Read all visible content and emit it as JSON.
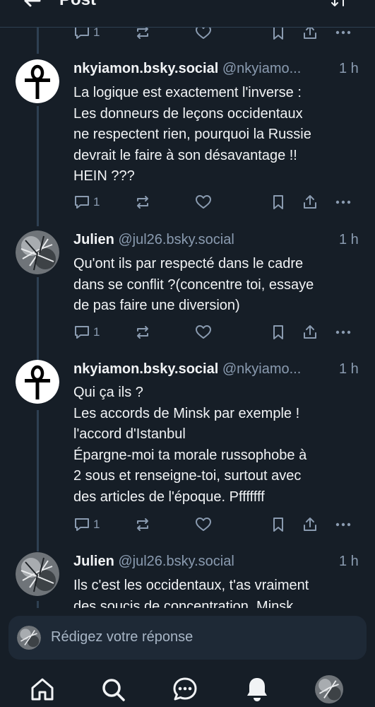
{
  "header": {
    "title": "Post"
  },
  "top_actions": {
    "reply_count": "1"
  },
  "posts": [
    {
      "display_name": "nkyiamon.bsky.social",
      "handle": "@nkyiamo...",
      "time": "1 h",
      "avatar": "ankh-icon",
      "lines": [
        "La logique est exactement l'inverse :",
        "Les donneurs de leçons occidentaux",
        "ne respectent rien, pourquoi la Russie",
        "devrait le faire à son désavantage !!",
        "HEIN ???"
      ],
      "reply_count": "1"
    },
    {
      "display_name": "Julien",
      "handle": "@jul26.bsky.social",
      "time": "1 h",
      "avatar": "tree-photo",
      "lines": [
        "Qu'ont ils par respecté dans le cadre",
        "dans se conflit ?(concentre toi, essaye",
        "de pas faire une diversion)"
      ],
      "reply_count": "1"
    },
    {
      "display_name": "nkyiamon.bsky.social",
      "handle": "@nkyiamo...",
      "time": "1 h",
      "avatar": "ankh-icon",
      "lines": [
        "Qui ça ils ?",
        "Les accords de Minsk par exemple !",
        "l'accord d'Istanbul",
        "Épargne-moi ta morale russophobe à",
        "2 sous et renseigne-toi, surtout avec",
        "des articles de l'époque. Pfffffff"
      ],
      "reply_count": "1"
    },
    {
      "display_name": "Julien",
      "handle": "@jul26.bsky.social",
      "time": "1 h",
      "avatar": "tree-photo",
      "lines": [
        "Ils c'est les occidentaux, t'as vraiment",
        "des soucis de concentration. Minsk"
      ]
    }
  ],
  "composer": {
    "placeholder": "Rédigez votre réponse"
  },
  "bottom_nav": [
    "home-icon",
    "search-icon",
    "chat-icon",
    "notifications-icon",
    "profile-avatar"
  ],
  "colors": {
    "background": "#161e27",
    "muted": "#8a9bb0",
    "divider": "#2e4052",
    "composer": "#1e2936"
  }
}
